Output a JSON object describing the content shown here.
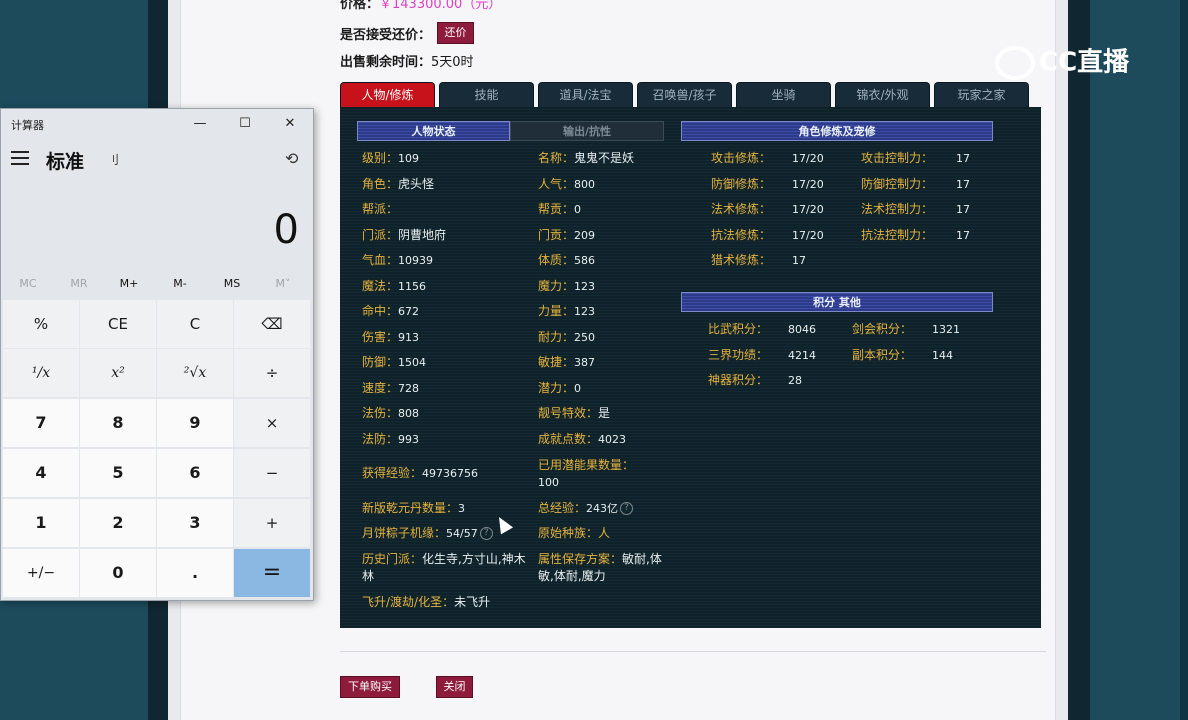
{
  "header": {
    "price_label": "价格：",
    "price_value": "￥143300.00（元）",
    "bargain_label": "是否接受还价：",
    "bargain_button": "还价",
    "time_label": "出售剩余时间：",
    "time_value": "5天0时"
  },
  "tabs": [
    {
      "label": "人物/修炼",
      "active": true
    },
    {
      "label": "技能"
    },
    {
      "label": "道具/法宝"
    },
    {
      "label": "召唤兽/孩子"
    },
    {
      "label": "坐骑"
    },
    {
      "label": "锦衣/外观"
    },
    {
      "label": "玩家之家"
    }
  ],
  "sections": {
    "char_status": "人物状态",
    "output_resist": "输出/抗性",
    "cultivation": "角色修炼及宠修",
    "points": "积分 其他"
  },
  "char_left": [
    {
      "k": "级别：",
      "v": "109"
    },
    {
      "k": "角色：",
      "v": "虎头怪"
    },
    {
      "k": "帮派：",
      "v": ""
    },
    {
      "k": "门派：",
      "v": "阴曹地府"
    },
    {
      "k": "气血：",
      "v": "10939"
    },
    {
      "k": "魔法：",
      "v": "1156"
    },
    {
      "k": "命中：",
      "v": "672"
    },
    {
      "k": "伤害：",
      "v": "913"
    },
    {
      "k": "防御：",
      "v": "1504"
    },
    {
      "k": "速度：",
      "v": "728"
    },
    {
      "k": "法伤：",
      "v": "808"
    },
    {
      "k": "法防：",
      "v": "993"
    }
  ],
  "char_right": [
    {
      "k": "名称：",
      "v": "鬼鬼不是妖"
    },
    {
      "k": "人气：",
      "v": "800"
    },
    {
      "k": "帮贡：",
      "v": "0"
    },
    {
      "k": "门贡：",
      "v": "209"
    },
    {
      "k": "体质：",
      "v": "586"
    },
    {
      "k": "魔力：",
      "v": "123"
    },
    {
      "k": "力量：",
      "v": "123"
    },
    {
      "k": "耐力：",
      "v": "250"
    },
    {
      "k": "敏捷：",
      "v": "387"
    },
    {
      "k": "潜力：",
      "v": "0"
    },
    {
      "k": "靓号特效：",
      "v": "是"
    },
    {
      "k": "成就点数：",
      "v": "4023"
    }
  ],
  "extra": {
    "exp_label": "获得经验：",
    "exp_value": "49736756",
    "potential_label": "已用潜能果数量：",
    "potential_value": "100",
    "qianyuan_label": "新版乾元丹数量：",
    "qianyuan_value": "3",
    "total_exp_label": "总经验：",
    "total_exp_value": "243亿",
    "zongzi_label": "月饼粽子机缘：",
    "zongzi_value": "54/57",
    "race_label": "原始种族：",
    "race_value": "人",
    "history_label": "历史门派：",
    "history_value": "化生寺,方寸山,神木林",
    "attr_label": "属性保存方案：",
    "attr_value": "敏耐,体敏,体耐,魔力",
    "ascend_label": "飞升/渡劫/化圣：",
    "ascend_value": "未飞升",
    "help_icon": "?"
  },
  "cultivation": [
    {
      "k1": "攻击修炼：",
      "v1": "17/20",
      "k2": "攻击控制力：",
      "v2": "17"
    },
    {
      "k1": "防御修炼：",
      "v1": "17/20",
      "k2": "防御控制力：",
      "v2": "17"
    },
    {
      "k1": "法术修炼：",
      "v1": "17/20",
      "k2": "法术控制力：",
      "v2": "17"
    },
    {
      "k1": "抗法修炼：",
      "v1": "17/20",
      "k2": "抗法控制力：",
      "v2": "17"
    },
    {
      "k1": "猎术修炼：",
      "v1": "17",
      "k2": "",
      "v2": ""
    }
  ],
  "points": [
    {
      "k1": "比武积分：",
      "v1": "8046",
      "k2": "剑会积分：",
      "v2": "1321"
    },
    {
      "k1": "三界功绩：",
      "v1": "4214",
      "k2": "副本积分：",
      "v2": "144"
    },
    {
      "k1": "神器积分：",
      "v1": "28",
      "k2": "",
      "v2": ""
    }
  ],
  "footer": {
    "buy_button": "下单购买",
    "close_button": "关闭"
  },
  "logo": {
    "text": "CC直播"
  },
  "calculator": {
    "title": "计算器",
    "minimize": "—",
    "maximize": "☐",
    "close": "✕",
    "mode": "标准",
    "mode_icon": "刂",
    "history_icon": "⟲",
    "display": "0",
    "memory": [
      "MC",
      "MR",
      "M+",
      "M-",
      "MS",
      "M˅"
    ],
    "keys": [
      [
        "%",
        "CE",
        "C",
        "⌫"
      ],
      [
        "¹/x",
        "x²",
        "²√x",
        "÷"
      ],
      [
        "7",
        "8",
        "9",
        "×"
      ],
      [
        "4",
        "5",
        "6",
        "−"
      ],
      [
        "1",
        "2",
        "3",
        "+"
      ],
      [
        "+/−",
        "0",
        ".",
        "="
      ]
    ]
  }
}
